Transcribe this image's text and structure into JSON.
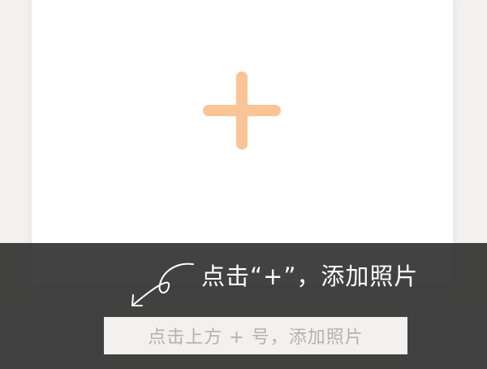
{
  "add_photo_card": {
    "icon": "plus-icon",
    "icon_color": "#f9c597"
  },
  "tip": {
    "text": "点击“+”，添加照片",
    "arrow_icon": "curved-arrow-icon"
  },
  "hint_bar": {
    "text": "点击上方 + 号，添加照片"
  },
  "colors": {
    "overlay": "#2a2a2a",
    "background": "#f2f1ef",
    "hint_text": "#b5b2ad"
  }
}
